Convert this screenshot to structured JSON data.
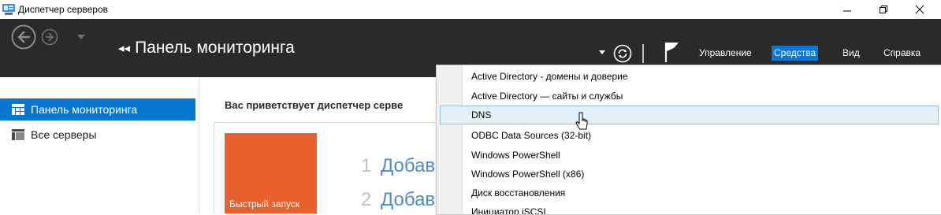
{
  "window": {
    "title": "Диспетчер серверов"
  },
  "header": {
    "page_title": "Панель мониторинга",
    "menu": [
      "Управление",
      "Средства",
      "Вид",
      "Справка"
    ],
    "active_menu_index": 1
  },
  "sidebar": {
    "items": [
      {
        "label": "Панель мониторинга",
        "icon": "dashboard-icon",
        "selected": true
      },
      {
        "label": "Все серверы",
        "icon": "servers-icon",
        "selected": false
      }
    ]
  },
  "main": {
    "welcome": "Вас приветствует диспетчер серве",
    "quick_start_label": "Быстрый запуск",
    "steps": [
      {
        "number": "1",
        "text": "Добав"
      },
      {
        "number": "2",
        "text": "Добав"
      }
    ]
  },
  "tools_menu": {
    "items": [
      "Active Directory - домены и доверие",
      "Active Directory — сайты и службы",
      "DNS",
      "ODBC Data Sources (32-bit)",
      "Windows PowerShell",
      "Windows PowerShell (x86)",
      "Диск восстановления",
      "Инициатор iSCSI"
    ],
    "highlighted_index": 2
  },
  "colors": {
    "header_bg": "#2a2a2a",
    "accent": "#0a76d4",
    "tile": "#e8612c",
    "step_link": "#4f8ccc",
    "hover_bg": "#e4f1fb"
  }
}
